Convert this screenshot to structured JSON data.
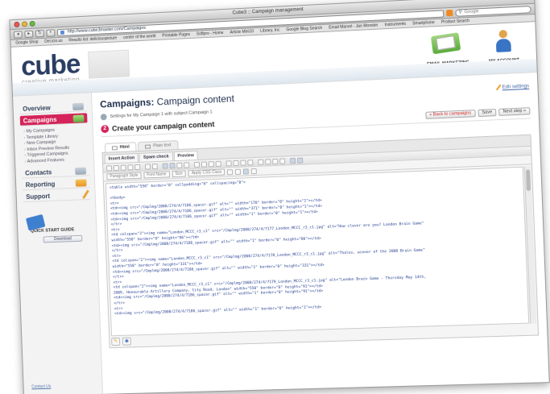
{
  "window": {
    "title": "Cube3 :: Campaign management",
    "url": "http://www.cube3master.com/Campaigns",
    "search_placeholder": "Google"
  },
  "bookmarks": [
    "Google Shop",
    "Del.icio.us",
    "Results list: deliciouspicture",
    "center of the world",
    "Printable Pages",
    "Softpro - Home",
    "Article Mini10",
    "Library, Inc",
    "Google Blog Search",
    "Email Marvel - Jan Monster",
    "Instruments",
    "Smartphone",
    "Product Search"
  ],
  "header": {
    "logo": "cube",
    "logo_sup": "3",
    "tagline": "creative marketing",
    "email_marketing": "EMAIL MARKETING",
    "my_account": "MY ACCOUNT"
  },
  "sidebar": {
    "overview": "Overview",
    "campaigns": "Campaigns",
    "campaign_items": [
      "My Campaigns",
      "Template Library",
      "New Campaign",
      "Inbox Preview Results",
      "Triggered Campaigns",
      "Advanced Features"
    ],
    "contacts": "Contacts",
    "reporting": "Reporting",
    "support": "Support",
    "quick_start": "QUICK START GUIDE",
    "download": "Download",
    "contact_us": "Contact Us"
  },
  "main": {
    "title_prefix": "Campaigns:",
    "title_rest": "Campaign content",
    "edit_settings": "Edit settings",
    "settings_line": "Settings for My Campaign 1 with subject Campaign 1",
    "step_number": "2",
    "step_title": "Create your campaign content",
    "back_button": "« Back to campaigns",
    "save_button": "Save",
    "next_button": "Next step »",
    "tabs": [
      "Html",
      "Plain text"
    ],
    "editor_tabs": [
      "Insert Action",
      "Spam check",
      "Preview"
    ],
    "paragraph_select": "Paragraph Style",
    "font_select": "Font Name",
    "size_select": "Size",
    "css_select": "Apply CSS Class"
  },
  "code_lines": [
    "<table width=\"550\" border=\"0\" cellpadding=\"0\" cellspacing=\"0\">",
    "",
    "  <tbody>",
    "    <tr>",
    "      <td><img src=\"/Cmplmg/2008/274/4/7186_spacer.gif\" alt=\"\" width=\"170\" border=\"0\" height=\"1\"></td>",
    "      <td><img src=\"/Cmplmg/2008/274/4/7186_spacer.gif\" alt=\"\" width=\"371\" border=\"0\" height=\"1\"></td>",
    "      <td><img src=\"/Cmplmg/2008/274/4/7186_spacer.gif\" alt=\"\" width=\"1\" border=\"0\" height=\"1\"></td>",
    "    </tr>",
    "    <tr>",
    "      <td colspan=\"2\"><img name=\"London_MCCC_r3_c1\" src=\"/Cmplmg/2008/274/4/7177_London_MCCC_r3_c1.jpg\" alt=\"How clever are you? London Brain Game\"",
    "width=\"550\" border=\"0\" height=\"86\"></td>",
    "      <td><img src=\"/Cmplmg/2008/274/4/7186_spacer.gif\" alt=\"\" width=\"1\" border=\"0\" height=\"86\"></td>",
    "    </tr>",
    "    <tr>",
    "      <td colspan=\"2\"><img name=\"London_MCCC_r3_c1\" src=\"/Cmplmg/2008/274/4/7178_London_MCCC_r3_c1.jpg\" alt=\"Thales, winner of the 2008 Brain Game\"",
    "width=\"550\" border=\"0\" height=\"331\"></td>",
    "      <td><img src=\"/Cmplmg/2008/274/4/7186_spacer.gif\" alt=\"\" width=\"1\" border=\"0\" height=\"331\"></td>",
    "    </tr>",
    "    <tr>",
    "      <td colspan=\"2\"><img name=\"London_MCCC_r3_c1\" src=\"/Cmplmg/2008/274/4/7179_London_MCCC_r3_c1.jpg\" alt=\"London Brain Game - Thursday May 14th,",
    "2009, Honourable Artillery Company, City Road, London\" width=\"550\" border=\"0\" height=\"91\"></td>",
    "      <td><img src=\"/Cmplmg/2008/274/4/7186_spacer.gif\" alt=\"\" width=\"1\" border=\"0\" height=\"91\"></td>",
    "    </tr>",
    "    <tr>",
    "      <td><img src=\"/Cmplmg/2008/274/4/7186_spacer.gif\" alt=\"\" width=\"1\" border=\"0\" height=\"1\"></td>"
  ]
}
